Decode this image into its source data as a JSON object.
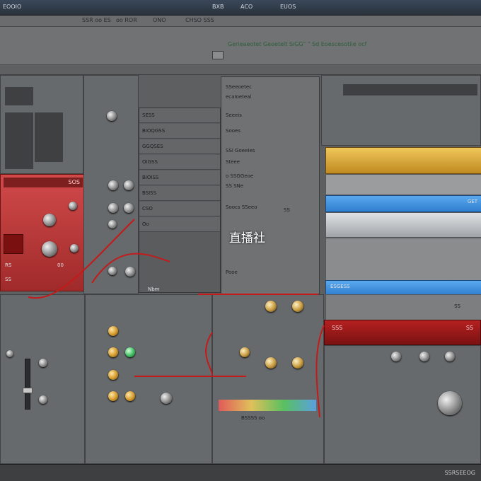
{
  "menubar": {
    "app_title": "EOOIO",
    "menu_items": [
      "BXB",
      "ACO",
      "EUOS"
    ]
  },
  "titlebar": {
    "title": "SSR oo ES",
    "items": [
      "oo ROR",
      "ONO",
      "CHSO SSS"
    ]
  },
  "toolbar": {
    "path": "Gerieaeotet Geoetelt SiGG\" \" Sd Eoescesotiie ocf"
  },
  "red_panel": {
    "title": "SOS",
    "labels": [
      "RS",
      "00",
      "SS"
    ]
  },
  "center_panel": {
    "rows": [
      "SSeeoetec",
      "ecaIoeteal",
      "Seeeis",
      "Sooes",
      "SSi  GoeeIes",
      "Steee",
      "o  SSGGeoe",
      "SS  SNe",
      "Soocs  SSeeo",
      "Pooe",
      "SS"
    ],
    "watermark": "直播社"
  },
  "list_panel": {
    "items": [
      "SESS",
      "BIOQGSS",
      "GGQSES",
      "OIGSS",
      "BIOISS",
      "BSISS",
      "CSO",
      "Oo"
    ],
    "footer": "Nbm"
  },
  "tracks": {
    "labels": [
      "ESGESS",
      "GET",
      "SS"
    ]
  },
  "red_bar": {
    "label_left": "SSS",
    "label_right": "SS"
  },
  "bottom_section": {
    "footer_label": "BSSSS oo",
    "status": "SSRSEEOG"
  },
  "colors": {
    "accent_red": "#b52020",
    "track_gold": "#d9a53a",
    "track_blue": "#2f7fd0",
    "accent_green": "#3fbf61"
  }
}
